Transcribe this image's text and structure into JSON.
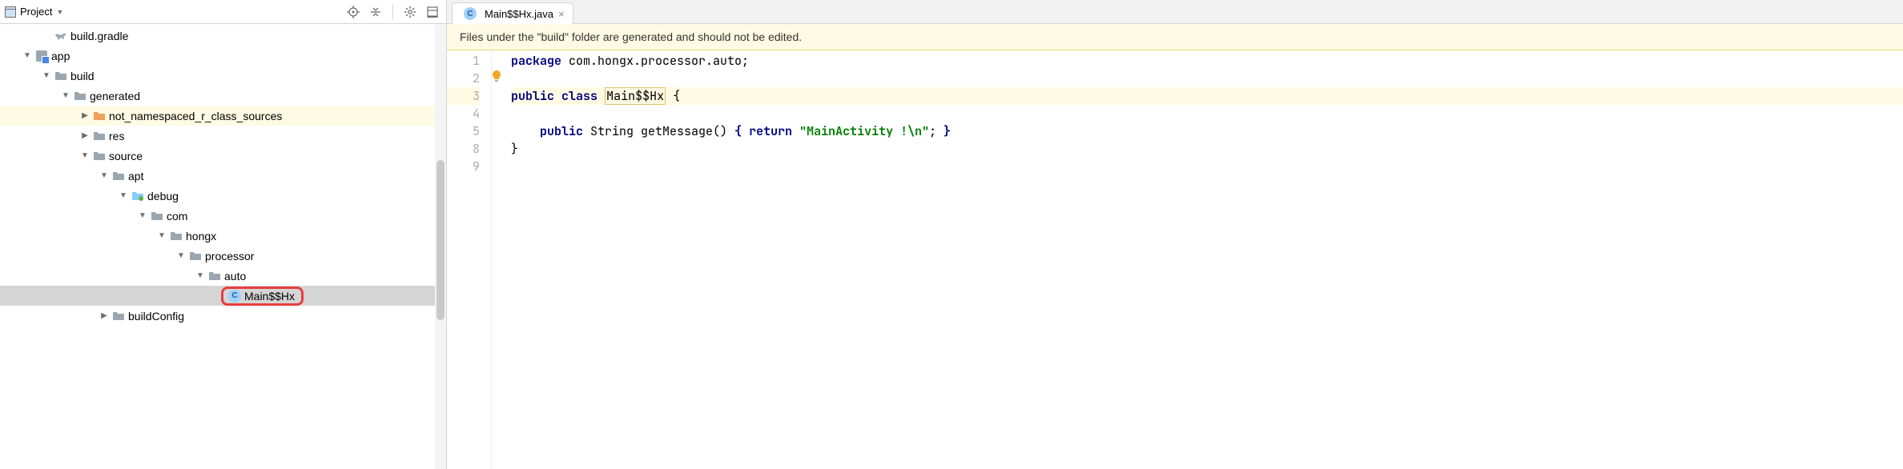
{
  "panel": {
    "title": "Project"
  },
  "tree": {
    "gradle": "build.gradle",
    "app": "app",
    "build": "build",
    "generated": "generated",
    "not_namespaced": "not_namespaced_r_class_sources",
    "res": "res",
    "source": "source",
    "apt": "apt",
    "debug": "debug",
    "com": "com",
    "hongx": "hongx",
    "processor": "processor",
    "auto": "auto",
    "mainhx": "Main$$Hx",
    "buildconfig": "buildConfig"
  },
  "tab": {
    "filename": "Main$$Hx.java"
  },
  "banner": {
    "text": "Files under the \"build\" folder are generated and should not be edited."
  },
  "code": {
    "lines": [
      "1",
      "2",
      "3",
      "4",
      "5",
      "8",
      "9"
    ],
    "l1_package": "package",
    "l1_pkg": " com.hongx.processor.auto;",
    "l3_public": "public",
    "l3_class": "class",
    "l3_name": "Main$$Hx",
    "l3_brace": " {",
    "l5_indent": "    ",
    "l5_public": "public",
    "l5_sig": " String getMessage() ",
    "l5_brace_open": "{",
    "l5_return": "return",
    "l5_str": "\"MainActivity !\\n\"",
    "l5_end": "; ",
    "l5_brace_close": "}",
    "l8": "}"
  }
}
